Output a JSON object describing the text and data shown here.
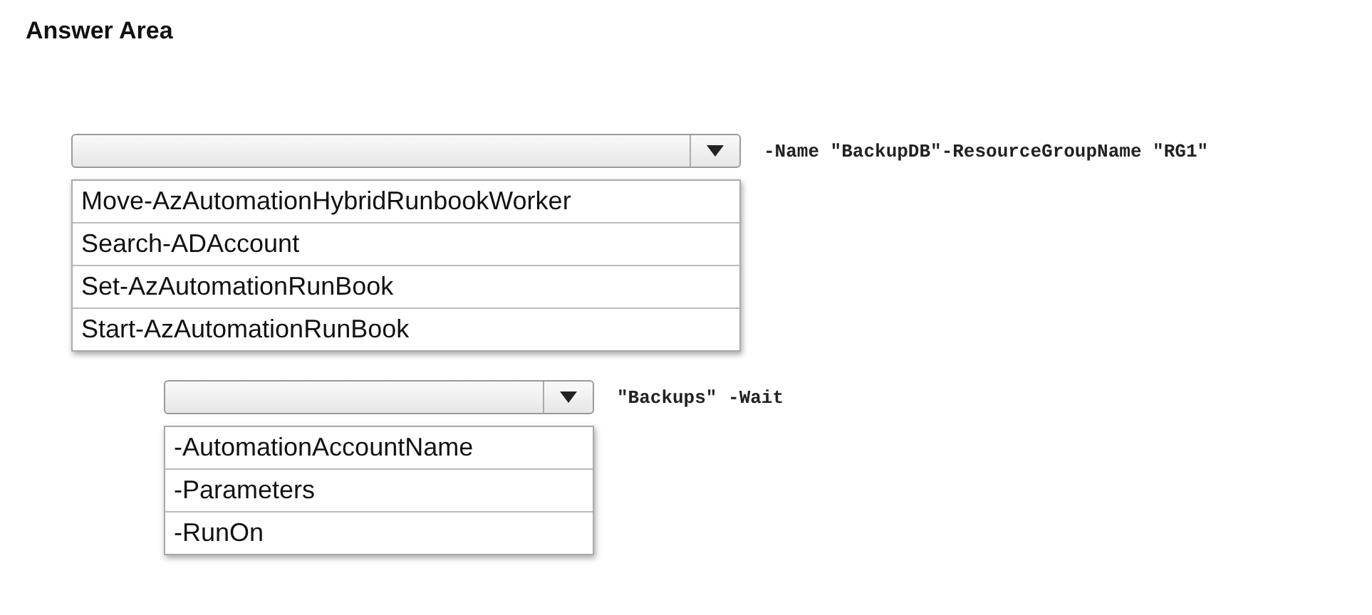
{
  "title": "Answer Area",
  "groups": [
    {
      "command_text": "-Name \"BackupDB\"-ResourceGroupName \"RG1\"",
      "options": [
        "Move-AzAutomationHybridRunbookWorker",
        "Search-ADAccount",
        "Set-AzAutomationRunBook",
        "Start-AzAutomationRunBook"
      ]
    },
    {
      "command_text": "\"Backups\" -Wait",
      "options": [
        "-AutomationAccountName",
        "-Parameters",
        "-RunOn"
      ]
    }
  ]
}
